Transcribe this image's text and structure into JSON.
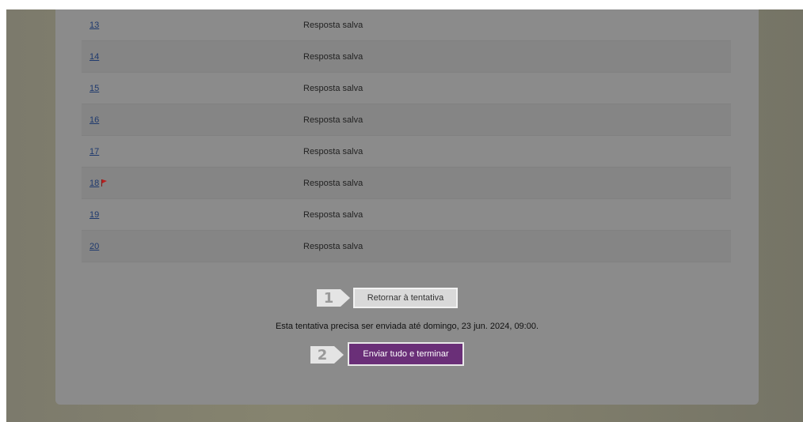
{
  "summary": {
    "rows": [
      {
        "num": "13",
        "status": "Resposta salva",
        "flagged": false
      },
      {
        "num": "14",
        "status": "Resposta salva",
        "flagged": false
      },
      {
        "num": "15",
        "status": "Resposta salva",
        "flagged": false
      },
      {
        "num": "16",
        "status": "Resposta salva",
        "flagged": false
      },
      {
        "num": "17",
        "status": "Resposta salva",
        "flagged": false
      },
      {
        "num": "18",
        "status": "Resposta salva",
        "flagged": true
      },
      {
        "num": "19",
        "status": "Resposta salva",
        "flagged": false
      },
      {
        "num": "20",
        "status": "Resposta salva",
        "flagged": false
      }
    ]
  },
  "steps": {
    "step1": "1",
    "step2": "2"
  },
  "actions": {
    "return_label": "Retornar à tentativa",
    "deadline_text": "Esta tentativa precisa ser enviada até domingo, 23 jun. 2024, 09:00.",
    "submit_label": "Enviar tudo e terminar"
  },
  "colors": {
    "submit_bg": "#6a2f78",
    "link": "#1f3a6e",
    "flag": "#b91f1f"
  }
}
